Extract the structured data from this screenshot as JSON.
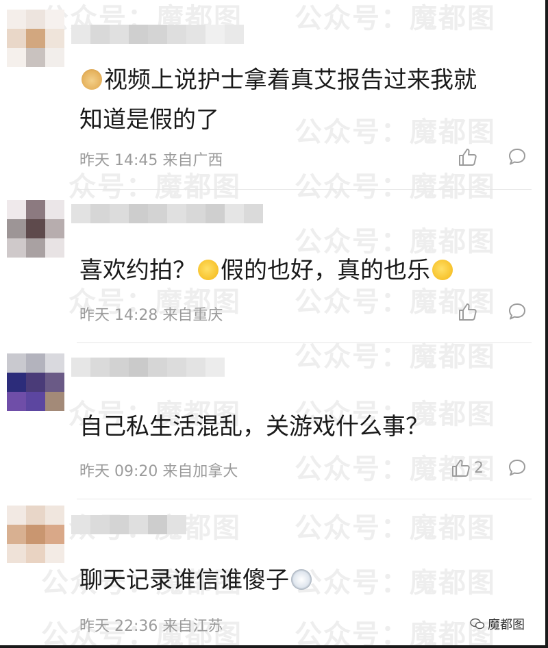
{
  "watermark": {
    "text": "公众号：魔都图",
    "short": "众号：魔都图",
    "tail": "魔都图"
  },
  "comments": [
    {
      "avatar_colors": [
        "#f4eeea",
        "#ede4de",
        "#f6f1ee",
        "#e9d7c8",
        "#d2a77f",
        "#efe4da",
        "#f5f0ec",
        "#c9c2bf",
        "#f2eeeb"
      ],
      "name_colors": [
        "#e8e8e8",
        "#d9d9d9",
        "#e0e0e0",
        "#cfcfcf",
        "#d4d4d4",
        "#dedede",
        "#e4e4e4",
        "#f0f0f0",
        "#e9e9e9"
      ],
      "text_line1": "视频上说护士拿着真艾报告过来我就",
      "text_line2": "知道是假的了",
      "time": "昨天 14:45 来自广西",
      "likes": ""
    },
    {
      "avatar_colors": [
        "#efe9eb",
        "#8c7a80",
        "#ebe6e8",
        "#9d9596",
        "#5e4a4c",
        "#b7adae",
        "#cfc9ca",
        "#a9a1a2",
        "#e8e3e4"
      ],
      "name_colors": [
        "#e2e2e2",
        "#d6d6d6",
        "#dcdcdc",
        "#cdcdcd",
        "#d3d3d3",
        "#e0e0e0",
        "#d8d8d8",
        "#cfcfcf",
        "#e5e5e5",
        "#dadada"
      ],
      "text": "喜欢约拍？假的也好，真的也乐",
      "time": "昨天 14:28 来自重庆",
      "likes": ""
    },
    {
      "avatar_colors": [
        "#c9c9cf",
        "#b3b3bd",
        "#d9d9de",
        "#2c2c7a",
        "#4a3b78",
        "#6a5a86",
        "#6f4ea8",
        "#5c46a0",
        "#a38a78"
      ],
      "name_colors": [
        "#e6e6e6",
        "#dadada",
        "#d2d2d2",
        "#cacaca",
        "#d6d6d6",
        "#dcdcdc",
        "#e3e3e3",
        "#ececec"
      ],
      "text": "自己私生活混乱，关游戏什么事？",
      "time": "昨天 09:20 来自加拿大",
      "likes": "2"
    },
    {
      "avatar_colors": [
        "#f2e9e3",
        "#e8d6c8",
        "#f0e6de",
        "#d8b091",
        "#c99670",
        "#d9a888",
        "#efe2d8",
        "#e9d3c2",
        "#f3ebe5"
      ],
      "name_colors": [
        "#e4e4e4",
        "#dbdbdb",
        "#d4d4d4",
        "#dfdfdf",
        "#cdcdcd",
        "#e2e2e2"
      ],
      "text": "聊天记录谁信谁傻子",
      "time": "昨天 22:36 来自江苏",
      "likes": ""
    }
  ],
  "footer": {
    "brand": "魔都图"
  }
}
